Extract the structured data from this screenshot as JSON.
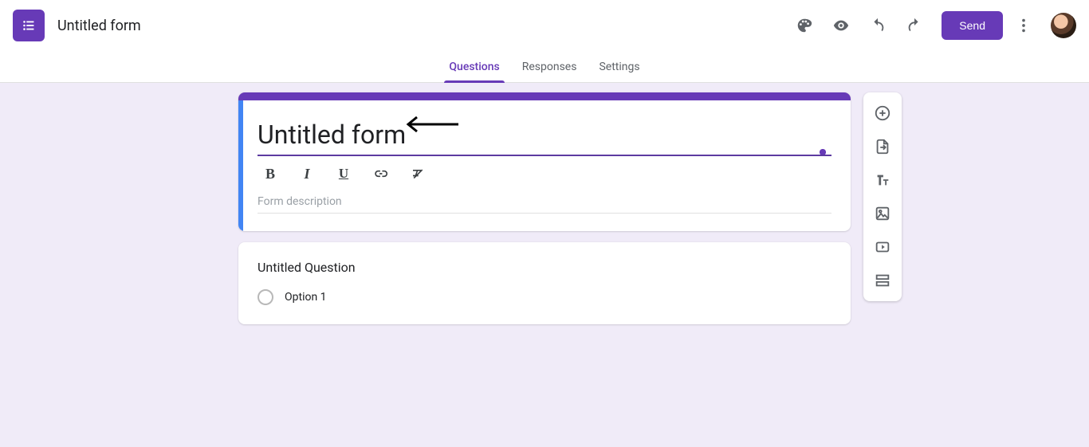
{
  "header": {
    "doc_title": "Untitled form",
    "send_label": "Send"
  },
  "tabs": {
    "questions": "Questions",
    "responses": "Responses",
    "settings": "Settings",
    "active": "questions"
  },
  "title_card": {
    "form_title": "Untitled form",
    "description_placeholder": "Form description",
    "format": {
      "bold": "B",
      "italic": "I",
      "underline": "U"
    }
  },
  "question_card": {
    "title": "Untitled Question",
    "option1": "Option 1"
  },
  "colors": {
    "accent": "#673ab7"
  }
}
